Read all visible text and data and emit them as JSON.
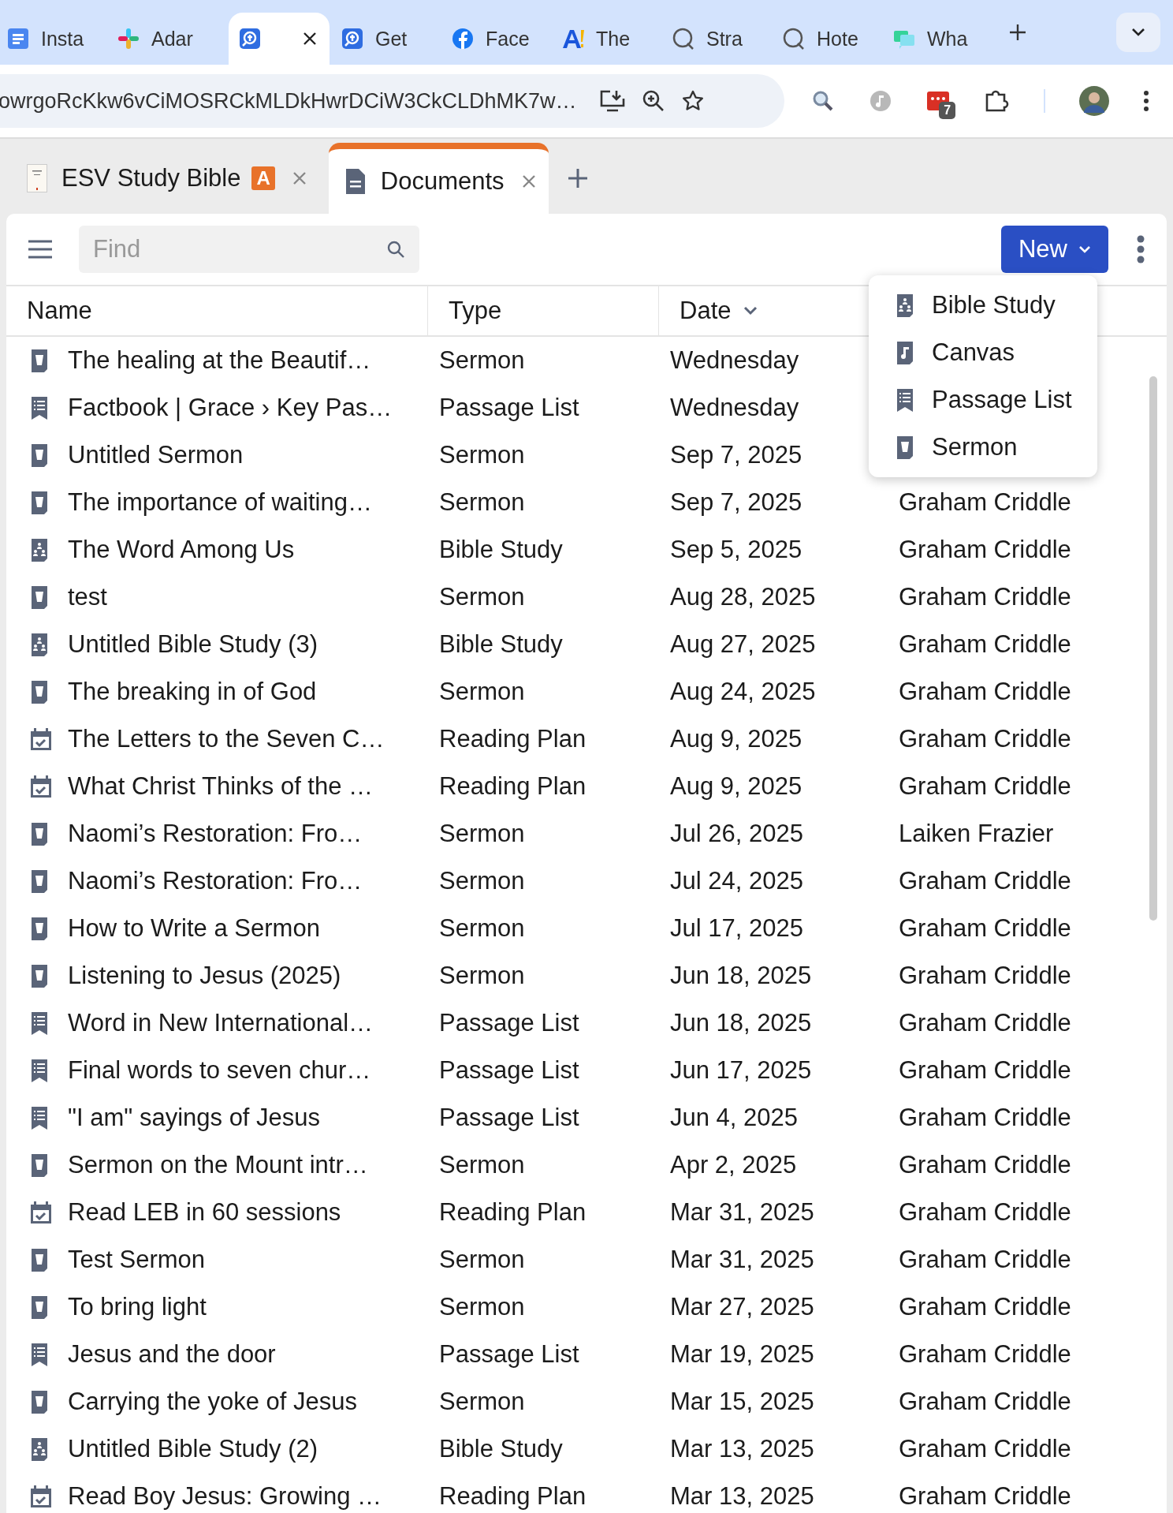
{
  "browser": {
    "tabs": [
      {
        "label": "Insta",
        "kind": "doc",
        "selected": false
      },
      {
        "label": "Adar",
        "kind": "slack",
        "selected": false
      },
      {
        "kind": "logos",
        "selected": true
      },
      {
        "label": "Get",
        "kind": "logos",
        "selected": false
      },
      {
        "label": "Face",
        "kind": "facebook",
        "selected": false
      },
      {
        "label": "The",
        "kind": "a",
        "selected": false
      },
      {
        "label": "Stra",
        "kind": "q",
        "selected": false
      },
      {
        "label": "Hote",
        "kind": "q",
        "selected": false
      },
      {
        "label": "Wha",
        "kind": "chat",
        "selected": false
      }
    ],
    "address": "owrgoRcKkw6vCiMOSRCkMLDkHwrDCiW3CkCLDhMK7w…",
    "extension_badge": "7"
  },
  "app_tabs": [
    {
      "title": "ESV Study Bible",
      "badge": "A",
      "kind": "book",
      "selected": false
    },
    {
      "title": "Documents",
      "kind": "doc",
      "selected": true
    }
  ],
  "toolbar": {
    "search": {
      "placeholder": "Find"
    },
    "new_button": "New"
  },
  "new_menu": [
    {
      "label": "Bible Study",
      "kind": "bible"
    },
    {
      "label": "Canvas",
      "kind": "canvas"
    },
    {
      "label": "Passage List",
      "kind": "passage"
    },
    {
      "label": "Sermon",
      "kind": "sermon"
    }
  ],
  "table": {
    "columns": [
      {
        "label": "Name",
        "sorted": false
      },
      {
        "label": "Type",
        "sorted": false
      },
      {
        "label": "Date",
        "sorted": true
      }
    ],
    "rows": [
      {
        "kind": "sermon",
        "name": "The healing at the Beautif…",
        "type": "Sermon",
        "date": "Wednesday"
      },
      {
        "kind": "passage",
        "name": "Factbook | Grace › Key Pas…",
        "type": "Passage List",
        "date": "Wednesday"
      },
      {
        "kind": "sermon",
        "name": "Untitled Sermon",
        "type": "Sermon",
        "date": "Sep 7, 2025"
      },
      {
        "kind": "sermon",
        "name": "The importance of waiting…",
        "type": "Sermon",
        "date": "Sep 7, 2025",
        "owner": "Graham Criddle"
      },
      {
        "kind": "bible",
        "name": "The Word Among Us",
        "type": "Bible Study",
        "date": "Sep 5, 2025",
        "owner": "Graham Criddle"
      },
      {
        "kind": "sermon",
        "name": "test",
        "type": "Sermon",
        "date": "Aug 28, 2025",
        "owner": "Graham Criddle"
      },
      {
        "kind": "bible",
        "name": "Untitled Bible Study (3)",
        "type": "Bible Study",
        "date": "Aug 27, 2025",
        "owner": "Graham Criddle"
      },
      {
        "kind": "sermon",
        "name": "The breaking in of God",
        "type": "Sermon",
        "date": "Aug 24, 2025",
        "owner": "Graham Criddle"
      },
      {
        "kind": "plan",
        "name": "The Letters to the Seven C…",
        "type": "Reading Plan",
        "date": "Aug 9, 2025",
        "owner": "Graham Criddle"
      },
      {
        "kind": "plan",
        "name": "What Christ Thinks of the …",
        "type": "Reading Plan",
        "date": "Aug 9, 2025",
        "owner": "Graham Criddle"
      },
      {
        "kind": "sermon",
        "name": "Naomi’s Restoration: Fro…",
        "type": "Sermon",
        "date": "Jul 26, 2025",
        "owner": "Laiken Frazier"
      },
      {
        "kind": "sermon",
        "name": "Naomi’s Restoration: Fro…",
        "type": "Sermon",
        "date": "Jul 24, 2025",
        "owner": "Graham Criddle"
      },
      {
        "kind": "sermon",
        "name": "How to Write a Sermon",
        "type": "Sermon",
        "date": "Jul 17, 2025",
        "owner": "Graham Criddle"
      },
      {
        "kind": "sermon",
        "name": "Listening to Jesus (2025)",
        "type": "Sermon",
        "date": "Jun 18, 2025",
        "owner": "Graham Criddle"
      },
      {
        "kind": "passage",
        "name": "Word in New International…",
        "type": "Passage List",
        "date": "Jun 18, 2025",
        "owner": "Graham Criddle"
      },
      {
        "kind": "passage",
        "name": "Final words to seven chur…",
        "type": "Passage List",
        "date": "Jun 17, 2025",
        "owner": "Graham Criddle"
      },
      {
        "kind": "passage",
        "name": "\"I am\" sayings of Jesus",
        "type": "Passage List",
        "date": "Jun 4, 2025",
        "owner": "Graham Criddle"
      },
      {
        "kind": "sermon",
        "name": "Sermon on the Mount intr…",
        "type": "Sermon",
        "date": "Apr 2, 2025",
        "owner": "Graham Criddle"
      },
      {
        "kind": "plan",
        "name": "Read LEB in 60 sessions",
        "type": "Reading Plan",
        "date": "Mar 31, 2025",
        "owner": "Graham Criddle"
      },
      {
        "kind": "sermon",
        "name": "Test Sermon",
        "type": "Sermon",
        "date": "Mar 31, 2025",
        "owner": "Graham Criddle"
      },
      {
        "kind": "sermon",
        "name": "To bring light",
        "type": "Sermon",
        "date": "Mar 27, 2025",
        "owner": "Graham Criddle"
      },
      {
        "kind": "passage",
        "name": "Jesus and the door",
        "type": "Passage List",
        "date": "Mar 19, 2025",
        "owner": "Graham Criddle"
      },
      {
        "kind": "sermon",
        "name": "Carrying the yoke of Jesus",
        "type": "Sermon",
        "date": "Mar 15, 2025",
        "owner": "Graham Criddle"
      },
      {
        "kind": "bible",
        "name": "Untitled Bible Study (2)",
        "type": "Bible Study",
        "date": "Mar 13, 2025",
        "owner": "Graham Criddle"
      },
      {
        "kind": "plan",
        "name": "Read Boy Jesus: Growing …",
        "type": "Reading Plan",
        "date": "Mar 13, 2025",
        "owner": "Graham Criddle"
      }
    ]
  }
}
